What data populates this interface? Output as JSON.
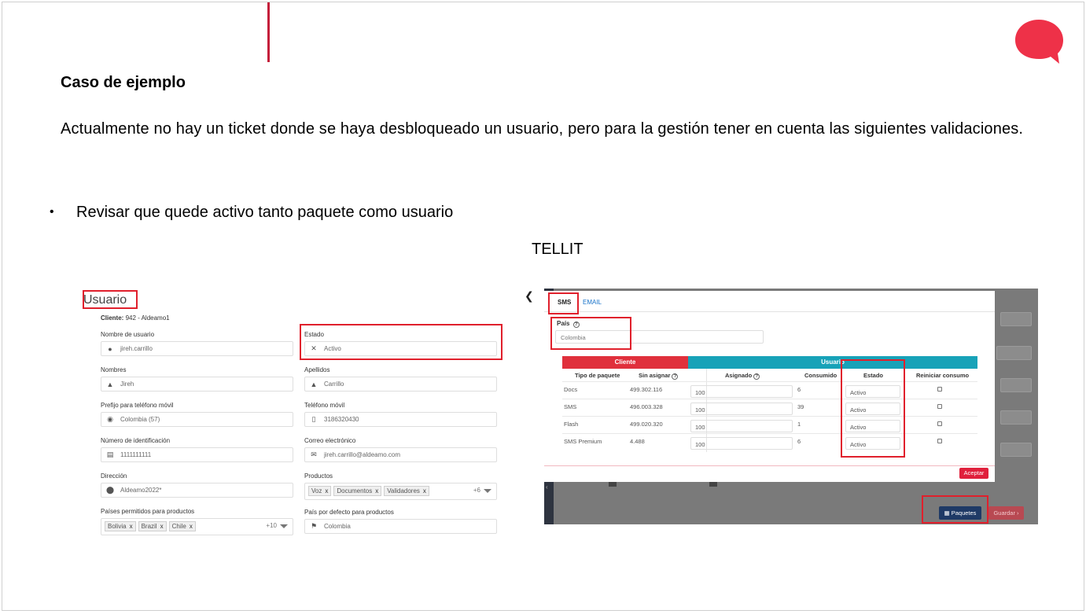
{
  "slide": {
    "title": "Caso de ejemplo",
    "description": "Actualmente no hay un ticket donde se haya desbloqueado un usuario, pero para la gestión tener en cuenta las siguientes validaciones.",
    "bullet_mark": "•",
    "bullet": "Revisar que quede activo tanto paquete como usuario",
    "section_label": "TELLIT",
    "accent_color": "#c41e3a",
    "logo_color": "#ee3148"
  },
  "usuario_form": {
    "title": "Usuario",
    "cliente_label": "Cliente:",
    "cliente_value": "942 - Aldeamo1",
    "fields": {
      "nombre_usuario": {
        "label": "Nombre de usuario",
        "value": "jireh.carrillo",
        "icon": "user-circle-icon"
      },
      "estado": {
        "label": "Estado",
        "value": "Activo",
        "icon": "user-slash-icon"
      },
      "nombres": {
        "label": "Nombres",
        "value": "Jireh",
        "icon": "user-icon"
      },
      "apellidos": {
        "label": "Apellidos",
        "value": "Carrillo",
        "icon": "user-icon"
      },
      "prefijo": {
        "label": "Prefijo para teléfono móvil",
        "value": "Colombia (57)",
        "icon": "globe-icon"
      },
      "telefono": {
        "label": "Teléfono móvil",
        "value": "3186320430",
        "icon": "mobile-icon"
      },
      "identificacion": {
        "label": "Número de identificación",
        "value": "1111111111",
        "icon": "id-card-icon"
      },
      "correo": {
        "label": "Correo electrónico",
        "value": "jireh.carrillo@aldeamo.com",
        "icon": "envelope-icon"
      },
      "direccion": {
        "label": "Dirección",
        "value": "Aldeamo2022*",
        "icon": "map-marker-icon"
      },
      "productos": {
        "label": "Productos",
        "chips": [
          "Voz",
          "Documentos",
          "Validadores"
        ],
        "more": "+6"
      },
      "paises": {
        "label": "Países permitidos para productos",
        "chips": [
          "Bolivia",
          "Brazil",
          "Chile"
        ],
        "more": "+10"
      },
      "pais_defecto": {
        "label": "País por defecto para productos",
        "value": "Colombia",
        "icon": "flag-icon"
      }
    },
    "chip_remove": "x"
  },
  "paquetes_modal": {
    "tabs": [
      "SMS",
      "EMAIL"
    ],
    "pais_label": "País",
    "pais_value": "Colombia",
    "group_headers": {
      "cliente": "Cliente",
      "usuario": "Usuario"
    },
    "columns": [
      "Tipo de paquete",
      "Sin asignar",
      "Asignado",
      "Consumido",
      "Estado",
      "Reiniciar consumo"
    ],
    "rows": [
      {
        "tipo": "Docs",
        "sin_asignar": "499.302.116",
        "asignado": "100",
        "consumido": "6",
        "estado": "Activo"
      },
      {
        "tipo": "SMS",
        "sin_asignar": "496.003.328",
        "asignado": "100",
        "consumido": "39",
        "estado": "Activo"
      },
      {
        "tipo": "Flash",
        "sin_asignar": "499.020.320",
        "asignado": "100",
        "consumido": "1",
        "estado": "Activo"
      },
      {
        "tipo": "SMS Premium",
        "sin_asignar": "4.488",
        "asignado": "100",
        "consumido": "6",
        "estado": "Activo"
      }
    ],
    "help_glyph": "?",
    "aceptar": "Aceptar"
  },
  "page_buttons": {
    "paquetes": "Paquetes",
    "guardar": "Guardar",
    "back_glyph": "❮",
    "collapse_glyph": "‹"
  }
}
